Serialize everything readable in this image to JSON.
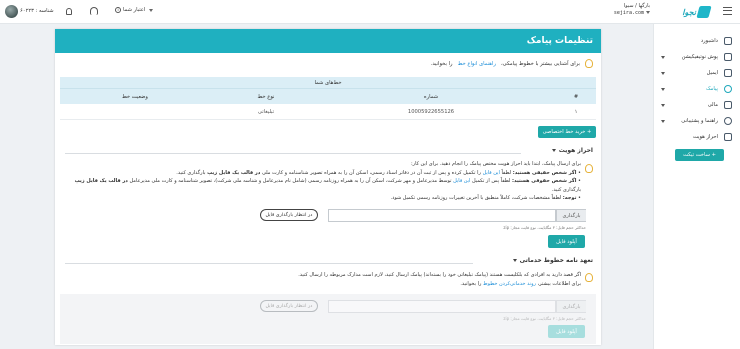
{
  "topbar": {
    "greeting": "بارگها / سیوا",
    "site": "sejira.com",
    "account_id": "شناسه : ۶۰۲۲۳",
    "credit_label": "اعتبار شما"
  },
  "sidebar": {
    "items": [
      {
        "label": "داشبورد",
        "icon": "dashboard-icon",
        "chevron": false
      },
      {
        "label": "پوش نوتیفیکیشن",
        "icon": "send-icon",
        "chevron": true
      },
      {
        "label": "ایمیل",
        "icon": "mail-icon",
        "chevron": true
      },
      {
        "label": "پیامک",
        "icon": "sms-icon",
        "chevron": true,
        "active": true
      },
      {
        "label": "مالی",
        "icon": "wallet-icon",
        "chevron": true
      },
      {
        "label": "راهنما و پشتیبانی",
        "icon": "headset-icon",
        "chevron": true
      },
      {
        "label": "احراز هویت",
        "icon": "lock-icon",
        "chevron": false
      }
    ],
    "support_button": "+ ساخت تیکت"
  },
  "page": {
    "title": "تنظیمات پیامک",
    "intro_text": "برای آشنایی بیشتر با خطوط پیامکی،",
    "intro_link": "راهنمای انواع خط",
    "intro_suffix": "را بخوانید.",
    "lines_table": {
      "caption": "خط‌های شما",
      "headers": {
        "num": "#",
        "number": "شماره",
        "type": "نوع خط",
        "status": "وضعیت خط"
      },
      "rows": [
        {
          "num": "۱",
          "number": "10005922655126",
          "type": "تبلیغاتی",
          "status": ""
        }
      ]
    },
    "buy_line_button": "+ خرید خط اختصاصی",
    "identity": {
      "title": "احراز هویت",
      "intro": "برای ارسال پیامک، ابتدا باید احراز هویت مختص پیامک را انجام دهید. برای این کار:",
      "real_person_label": "اگر شخص حقیقی هستید:",
      "real_person_text_1": "لطفاً",
      "real_person_link": "این فایل",
      "real_person_text_2": "را تکمیل کرده و پس از ثبت آن در دفاتر اسناد رسمی، اسکن آن را به همراه تصویر شناسنامه و کارت ملی",
      "real_person_bold": "در قالب یک فایل زیپ",
      "real_person_text_3": "بارگذاری کنید.",
      "legal_person_label": "اگر شخص حقوقی هستید:",
      "legal_person_text_1": "لطفاً پس از تکمیل",
      "legal_person_link": "این فایل",
      "legal_person_text_2": "توسط مدیرعامل و مهر شرکت، اسکن آن را به همراه روزنامه رسمی (شامل نام مدیرعامل و شناسه ملی شرکت)، تصویر شناسنامه و کارت ملی مدیرعامل",
      "legal_person_bold": "در قالب یک فایل زیپ",
      "legal_person_text_3": "بارگذاری کنید.",
      "note_label": "توجه:",
      "note_text": "لطفاً مشخصات شرکت، کاملاً منطبق با آخرین تغییرات روزنامه رسمی تکمیل شود.",
      "file_button": "بارگذاری",
      "upload_status": "در انتظار بارگذاری فایل",
      "hint": "حداکثر حجم فایل: ۳ مگابایت. نوع فایت مجاز: zip",
      "submit_button": "آپلود فایل"
    },
    "commitment": {
      "title": "تعهد نامه خطوط خدماتی",
      "text_1": "اگر قصد دارید به افرادی که بلکلیست هستند (پیامک تبلیغاتی خود را بسته‌اند) پیامک ارسال کنید، لازم است مدارک مربوطه را ارسال کنید.",
      "text_2": "برای اطلاعات بیشتر،",
      "link": "روند خدماتی‌کردن خطوط",
      "text_3": "را بخوانید.",
      "file_button": "بارگذاری",
      "upload_status": "در انتظار بارگذاری فایل",
      "hint": "حداکثر حجم فایل: ۳ مگابایت. نوع فایت مجاز: zip",
      "submit_button": "آپلود فایل"
    }
  },
  "colors": {
    "accent": "#1fb0c0",
    "button": "#1fa8a8",
    "link": "#1f8fd8",
    "bulb": "#e6b23a"
  }
}
